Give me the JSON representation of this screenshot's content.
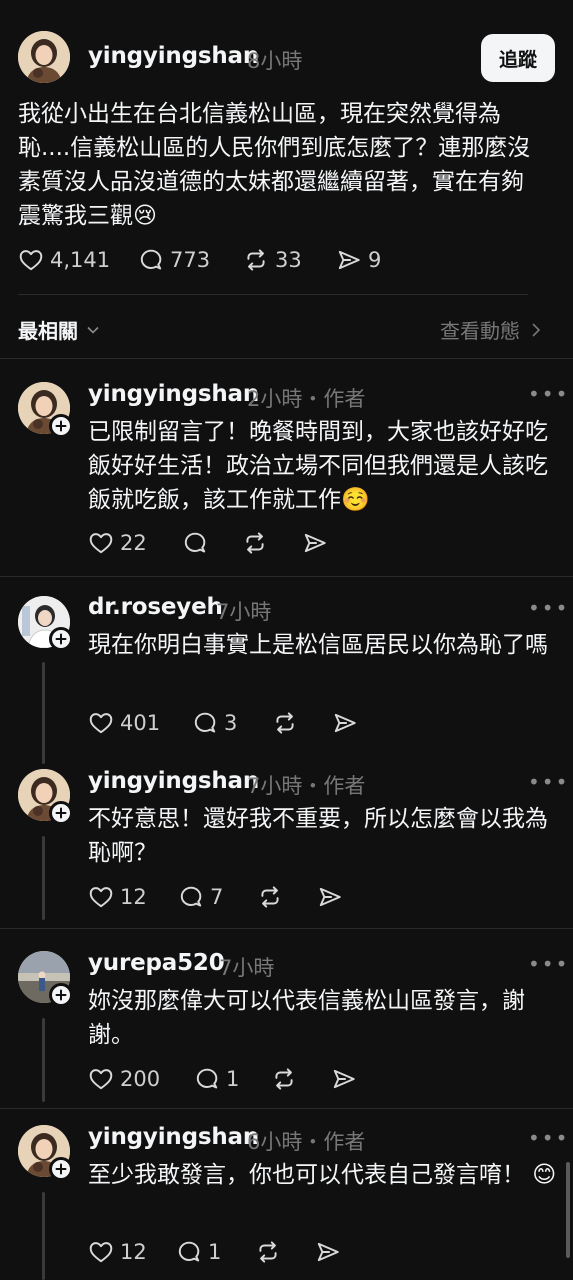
{
  "post": {
    "username": "yingyingshan",
    "time": "8小時",
    "follow_label": "追蹤",
    "text": "我從小出生在台北信義松山區，現在突然覺得為恥....信義松山區的人民你們到底怎麼了？連那麼沒素質沒人品沒道德的太妹都還繼續留著，實在有夠震驚我三觀😢",
    "likes": "4,141",
    "comments": "773",
    "reposts": "33",
    "shares": "9"
  },
  "sort": {
    "label": "最相關",
    "activity_label": "查看動態"
  },
  "replies": [
    {
      "username": "yingyingshan",
      "time": "2小時",
      "author_tag": "・作者",
      "text": "已限制留言了！晚餐時間到，大家也該好好吃飯好好生活！政治立場不同但我們還是人該吃飯就吃飯，該工作就工作☺️",
      "likes": "22",
      "comments": ""
    },
    {
      "username": "dr.roseyeh",
      "time": "7小時",
      "author_tag": "",
      "text": "現在你明白事實上是松信區居民以你為恥了嗎",
      "likes": "401",
      "comments": "3"
    },
    {
      "username": "yingyingshan",
      "time": "7小時",
      "author_tag": "・作者",
      "text": "不好意思！還好我不重要，所以怎麼會以我為恥啊？",
      "likes": "12",
      "comments": "7"
    },
    {
      "username": "yurepa520",
      "time": "7小時",
      "author_tag": "",
      "text": "妳沒那麼偉大可以代表信義松山區發言，謝謝。",
      "likes": "200",
      "comments": "1"
    },
    {
      "username": "yingyingshan",
      "time": "6小時",
      "author_tag": "・作者",
      "text": "至少我敢發言，你也可以代表自己發言唷！ 😊",
      "likes": "12",
      "comments": "1"
    }
  ],
  "colors": {
    "background": "#101010",
    "text": "#f3f5f7",
    "muted": "#777777",
    "divider": "#2a2a2a"
  },
  "icons": {
    "like": "heart-icon",
    "comment": "comment-bubble-icon",
    "repost": "repost-icon",
    "share": "send-icon",
    "more": "more-dots-icon",
    "follow": "plus-icon"
  }
}
